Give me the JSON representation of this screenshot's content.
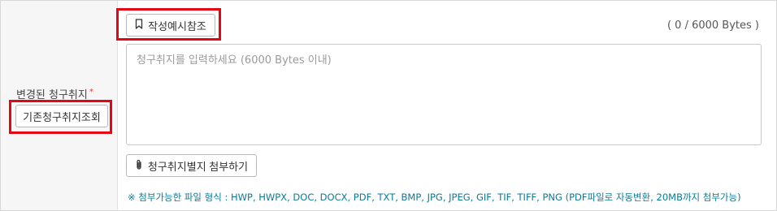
{
  "form": {
    "field_label": "변경된 청구취지",
    "required_mark": "*",
    "lookup_button_label": "기존청구취지조회",
    "example_button_label": "작성예시참조",
    "byte_counter": "( 0 / 6000 Bytes )",
    "textarea_placeholder": "청구취지를 입력하세요 (6000 Bytes 이내)",
    "textarea_value": "",
    "attach_button_label": "청구취지별지 첨부하기",
    "notice": "※ 첨부가능한 파일 형식 : HWP, HWPX, DOC, DOCX, PDF, TXT, BMP, JPG, JPEG, GIF, TIF, TIFF, PNG (PDF파일로 자동변환, 20MB까지 첨부가능)"
  },
  "colors": {
    "highlight": "#e30613",
    "notice_text": "#0b7b95",
    "required": "#e23b3b"
  },
  "icons": {
    "example_button": "bookmark-icon",
    "attach_button": "paperclip-icon"
  }
}
